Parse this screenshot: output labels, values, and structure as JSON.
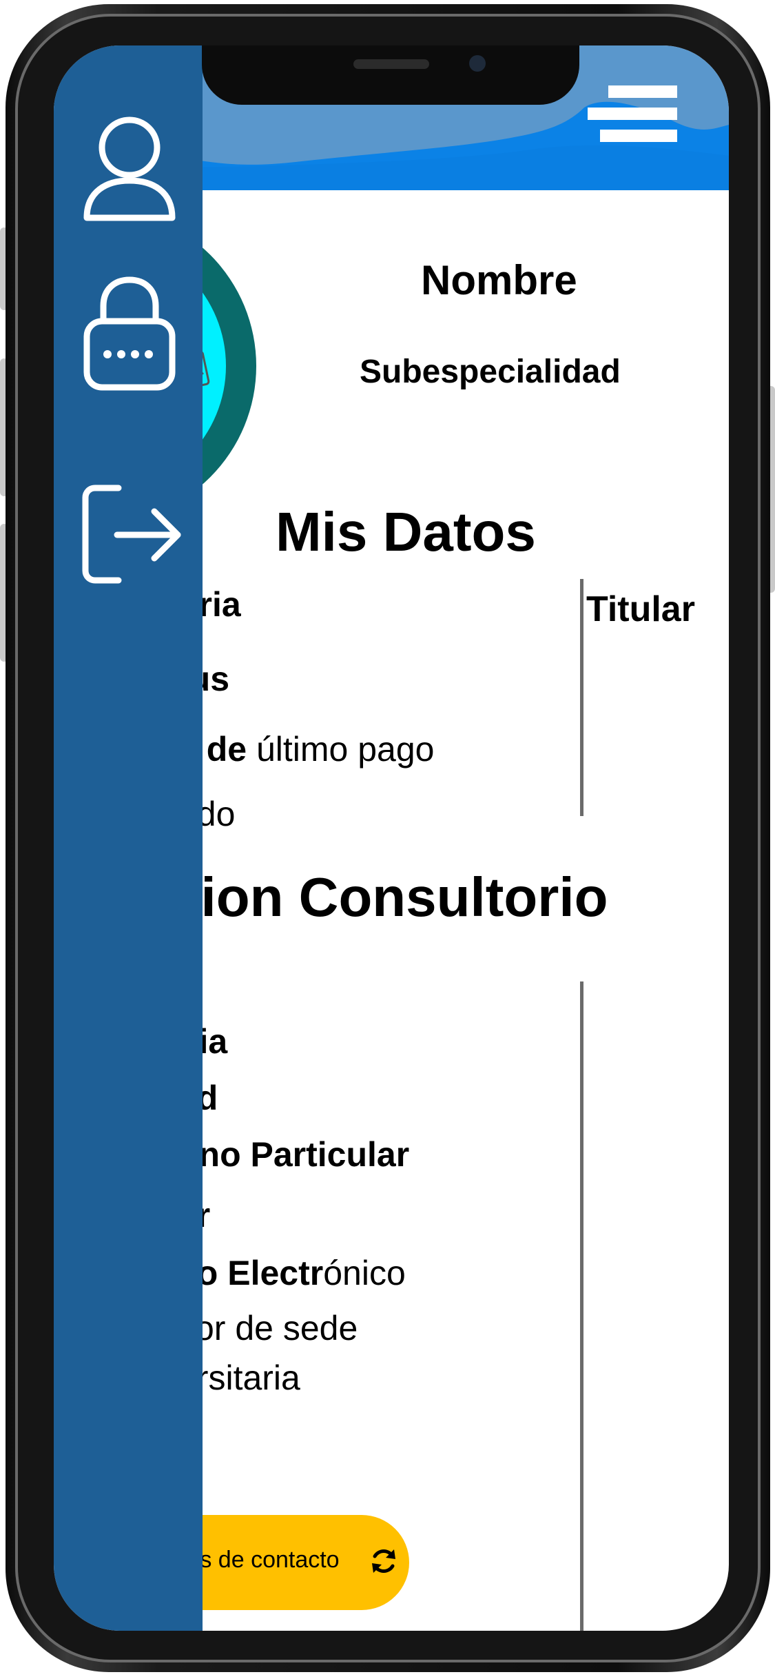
{
  "colors": {
    "sidebar": "#1e5f96",
    "header_sky": "#5a97cc",
    "header_wave": "#0b82e6",
    "ring_outer": "#0a6a6a",
    "ring_inner": "#00f0ff",
    "accent_button": "#ffc000"
  },
  "sidebar": {
    "items": [
      {
        "icon": "user-icon"
      },
      {
        "icon": "lock-icon"
      },
      {
        "icon": "logout-icon"
      }
    ]
  },
  "header": {
    "menu_icon": "hamburger-menu-icon"
  },
  "profile": {
    "name": "Nombre",
    "subspecialty": "Subespecialidad",
    "photo_icon": "image-placeholder-icon"
  },
  "mis_datos": {
    "title": "Mis Datos",
    "category_bold": "oria",
    "status_bold": "tus",
    "last_payment_bold": "a de ",
    "last_payment_rest": "último pago",
    "balance": "udo",
    "titular": "Titular"
  },
  "direccion": {
    "title": "eccion Consultorio",
    "colony_bold": "nia",
    "city_bold": "ad",
    "phone_bold": "ono Particular",
    "cell_bold": "ar",
    "email_bold": "eo Electr",
    "email_rest": "ónico",
    "advisor_line1": "sor de sede",
    "advisor_line2": "ersitaria"
  },
  "contact_button": {
    "label": "tos de contacto",
    "icon": "refresh-icon"
  }
}
